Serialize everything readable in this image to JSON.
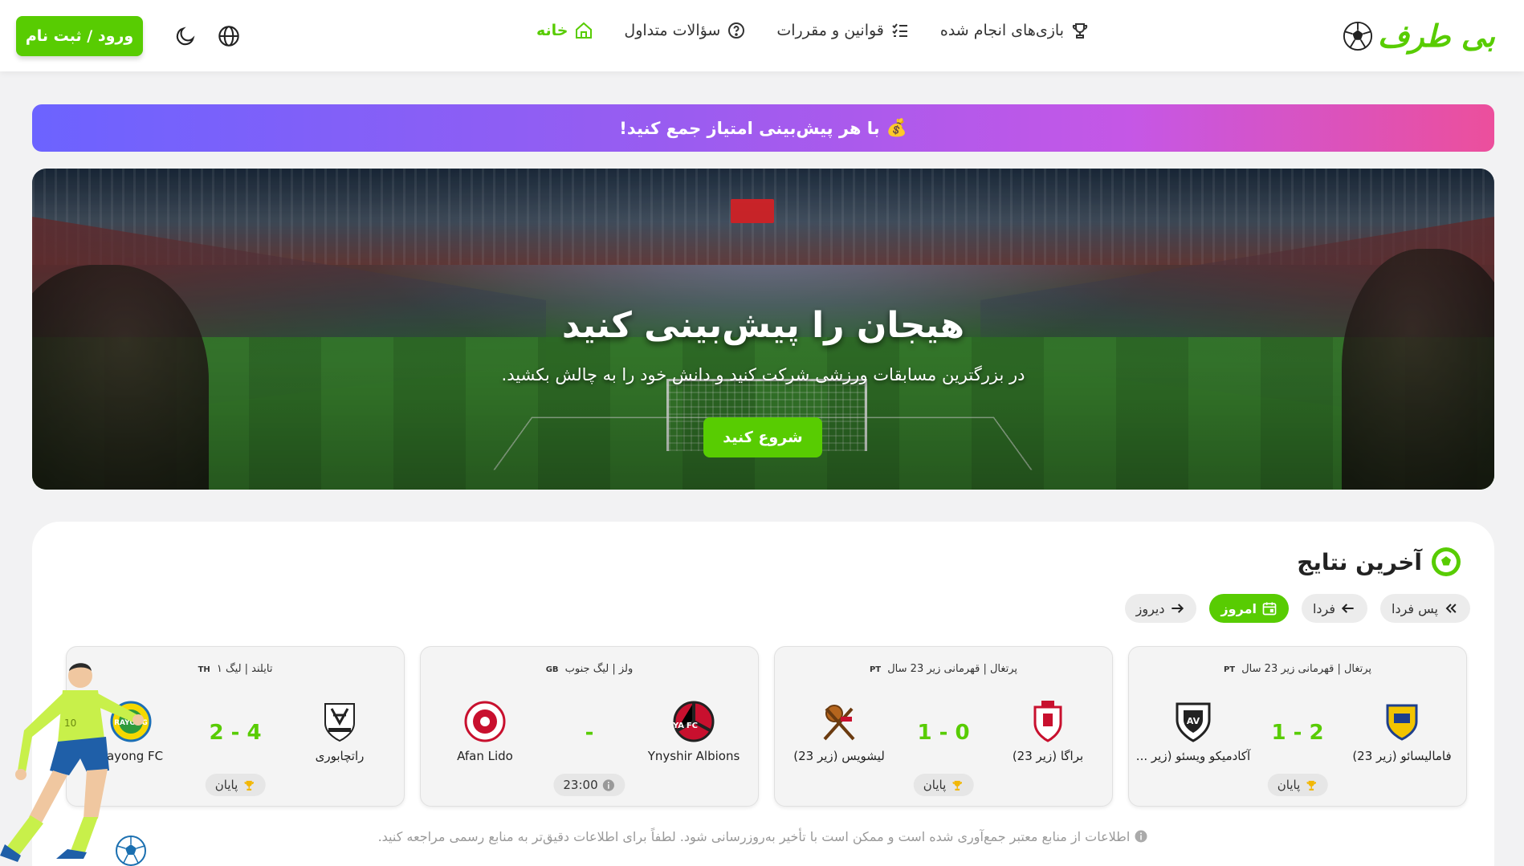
{
  "header": {
    "logo_text": "بی طرف",
    "nav": [
      {
        "label": "خانه",
        "icon": "home-icon",
        "active": true
      },
      {
        "label": "سؤالات متداول",
        "icon": "question-icon",
        "active": false
      },
      {
        "label": "قوانین و مقررات",
        "icon": "list-check-icon",
        "active": false
      },
      {
        "label": "بازی‌های انجام شده",
        "icon": "trophy-icon",
        "active": false
      }
    ],
    "login_label": "ورود / ثبت نام",
    "accent_color": "#58cc02"
  },
  "promo": {
    "emoji": "💰",
    "text": "با هر پیش‌بینی امتیاز جمع کنید!"
  },
  "hero": {
    "title": "هیجان را پیش‌بینی کنید",
    "subtitle": "در بزرگترین مسابقات ورزشی شرکت کنید و دانش خود را به چالش بکشید.",
    "cta_label": "شروع کنید"
  },
  "results": {
    "title": "آخرین نتایج",
    "tabs": [
      {
        "label": "دیروز",
        "icon": "arrow-right-icon",
        "active": false
      },
      {
        "label": "امروز",
        "icon": "calendar-icon",
        "active": true
      },
      {
        "label": "فردا",
        "icon": "arrow-left-icon",
        "active": false
      },
      {
        "label": "پس فردا",
        "icon": "double-chevron-left-icon",
        "active": false
      }
    ],
    "matches": [
      {
        "league": "پرتغال | قهرمانی زیر 23 سال",
        "country_code": "PT",
        "home": "فامالیسائو (زیر 23)",
        "away": "آکادمیکو ویسئو (زیر ...",
        "score": "1 - 2",
        "status": "پایان",
        "status_icon": "trophy-icon"
      },
      {
        "league": "پرتغال | قهرمانی زیر 23 سال",
        "country_code": "PT",
        "home": "براگا (زیر 23)",
        "away": "لیشویس (زیر 23)",
        "score": "1 - 0",
        "status": "پایان",
        "status_icon": "trophy-icon"
      },
      {
        "league": "ولز | لیگ جنوب",
        "country_code": "GB",
        "home": "Ynyshir Albions",
        "away": "Afan Lido",
        "score": "-",
        "status": "23:00",
        "status_icon": "info-icon"
      },
      {
        "league": "تایلند | لیگ ۱",
        "country_code": "TH",
        "home": "راتچابوری",
        "away": "Rayong FC",
        "score": "2 - 4",
        "status": "پایان",
        "status_icon": "trophy-icon"
      }
    ],
    "disclaimer": "اطلاعات از منابع معتبر جمع‌آوری شده است و ممکن است با تأخیر به‌روزرسانی شود. لطفاً برای اطلاعات دقیق‌تر به منابع رسمی مراجعه کنید."
  }
}
